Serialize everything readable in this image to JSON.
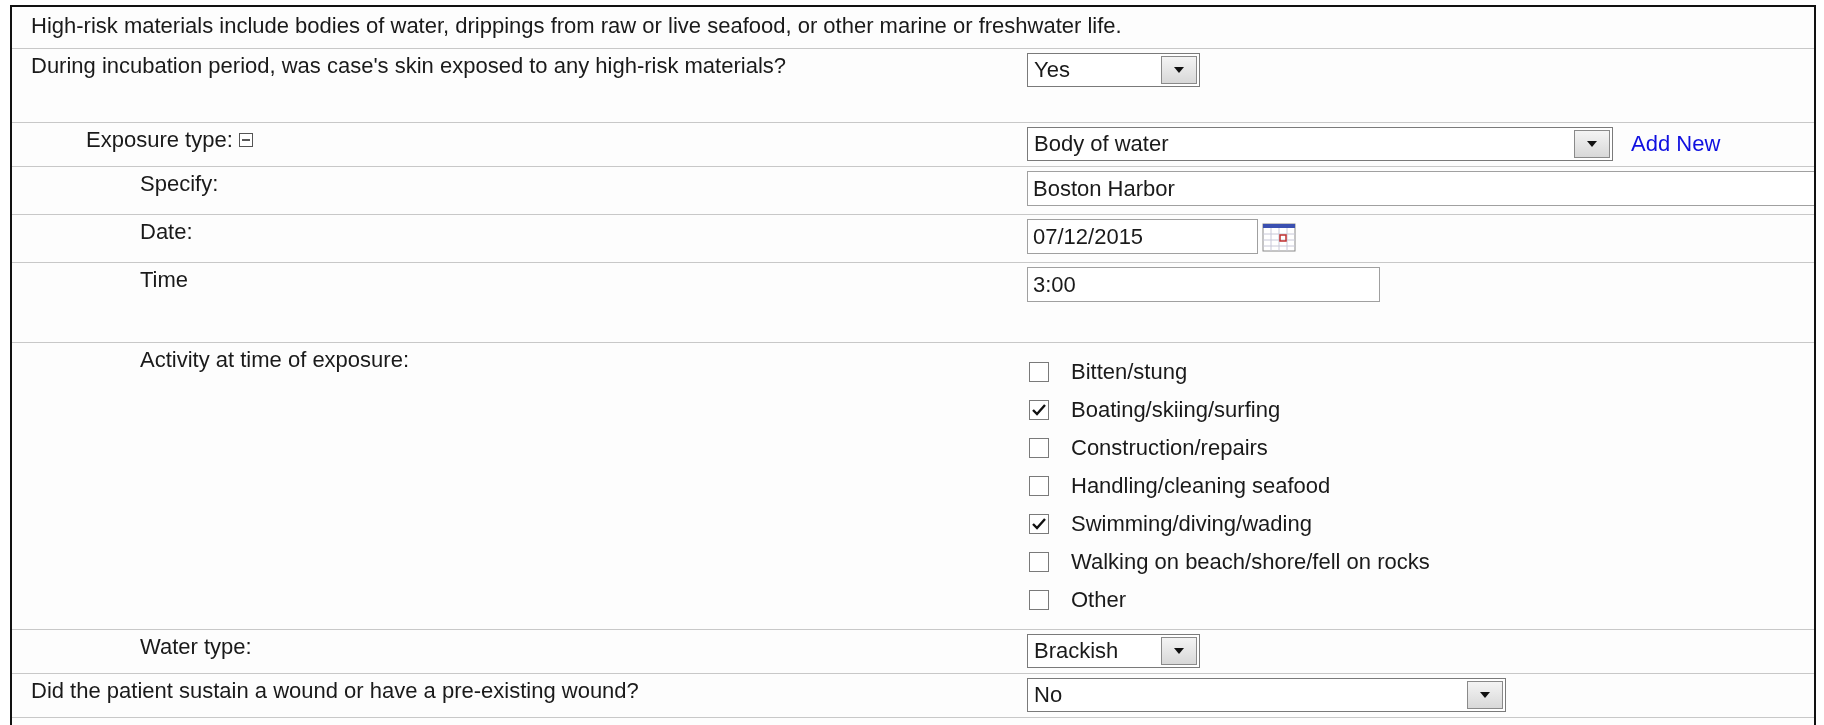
{
  "notice": "High-risk materials include bodies of water, drippings from raw or live seafood, or other marine or freshwater life.",
  "questions": [
    {
      "kind": "select",
      "label": "During incubation period, was case's skin exposed to any high-risk materials?",
      "value": "Yes",
      "children": [
        {
          "kind": "select",
          "label": "Exposure type:",
          "expanded": true,
          "value": "Body of water",
          "link": "Add New",
          "children": [
            {
              "kind": "text",
              "label": "Specify:",
              "value": "Boston Harbor"
            },
            {
              "kind": "date",
              "label": "Date:",
              "value": "07/12/2015"
            },
            {
              "kind": "time",
              "label": "Time",
              "value": "3:00"
            },
            {
              "kind": "checkboxes",
              "label": "Activity at time of exposure:",
              "options": [
                {
                  "label": "Bitten/stung",
                  "checked": false
                },
                {
                  "label": "Boating/skiing/surfing",
                  "checked": true
                },
                {
                  "label": "Construction/repairs",
                  "checked": false
                },
                {
                  "label": "Handling/cleaning seafood",
                  "checked": false
                },
                {
                  "label": "Swimming/diving/wading",
                  "checked": true
                },
                {
                  "label": "Walking on beach/shore/fell on rocks",
                  "checked": false
                },
                {
                  "label": "Other",
                  "checked": false
                }
              ]
            },
            {
              "kind": "select",
              "label": "Water type:",
              "value": "Brackish"
            }
          ]
        }
      ]
    },
    {
      "kind": "select",
      "label": "Did the patient sustain a wound or have a pre-existing wound?",
      "value": "No"
    }
  ]
}
